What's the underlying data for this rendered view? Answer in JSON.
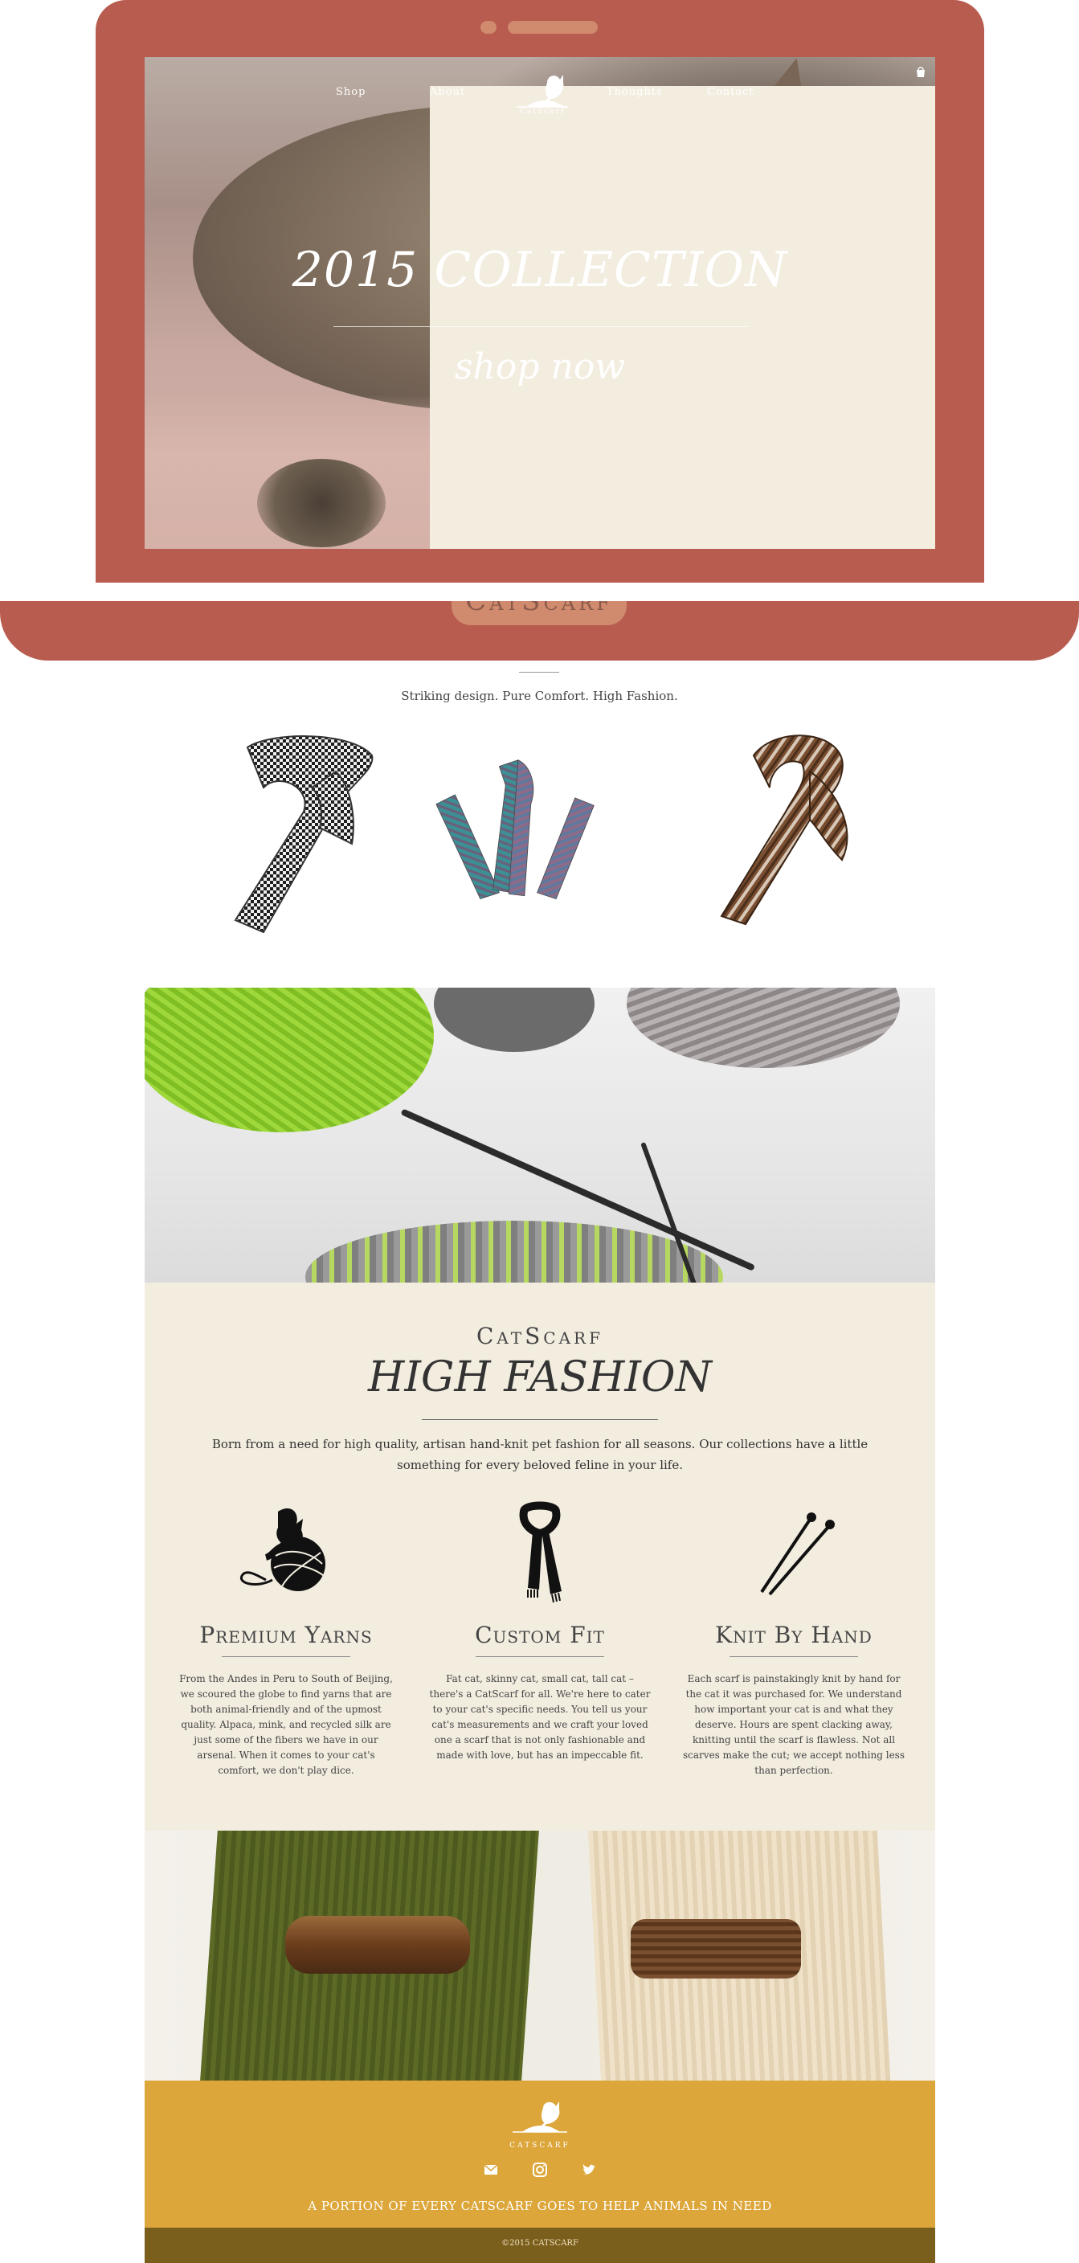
{
  "nav": {
    "shop": "Shop",
    "about": "About",
    "thoughts": "Thoughts",
    "contact": "Contact",
    "logo_text": "CatScarf"
  },
  "hero": {
    "title": "2015 COLLECTION",
    "cta": "shop now"
  },
  "laptop": {
    "base_text": "CatScarf"
  },
  "tagline": "Striking design. Pure Comfort. High Fashion.",
  "about": {
    "brand": "CatScarf",
    "title": "HIGH FASHION",
    "intro": "Born from a need for high quality, artisan hand-knit pet fashion for all seasons. Our collections have a little something for every beloved feline in your life.",
    "features": [
      {
        "icon": "yarn-ball-cat-icon",
        "title": "Premium Yarns",
        "text": "From the Andes in Peru to South of Beijing, we scoured the globe to find yarns that are both animal-friendly and of the upmost quality. Alpaca, mink, and recycled silk are just some of the fibers we have in our arsenal. When it comes to your cat's comfort, we don't play dice."
      },
      {
        "icon": "scarf-icon",
        "title": "Custom Fit",
        "text": "Fat cat, skinny cat, small cat, tall cat – there's a CatScarf for all. We're here to cater to your cat's specific needs. You tell us your cat's measurements and we craft your loved one a scarf that is not only fashionable and made with love, but has an impeccable fit."
      },
      {
        "icon": "knitting-needles-icon",
        "title": "Knit By Hand",
        "text": "Each scarf is painstakingly knit by hand for the cat it was purchased for. We understand how important your cat is and what they deserve. Hours are spent clacking away, knitting until the scarf is flawless. Not all scarves make the cut; we accept nothing less than perfection."
      }
    ]
  },
  "footer": {
    "brand": "CATSCARF",
    "message": "A PORTION OF EVERY CATSCARF GOES TO HELP ANIMALS IN NEED",
    "icons": [
      "envelope-icon",
      "instagram-icon",
      "twitter-icon"
    ],
    "copyright": "©2015 CATSCARF"
  },
  "colors": {
    "laptop": "#b85c4f",
    "laptop_accent": "#d08a6e",
    "about_bg": "#f3ede0",
    "footer_bg": "#dca63a",
    "copyright_bg": "#7a5e1c"
  }
}
